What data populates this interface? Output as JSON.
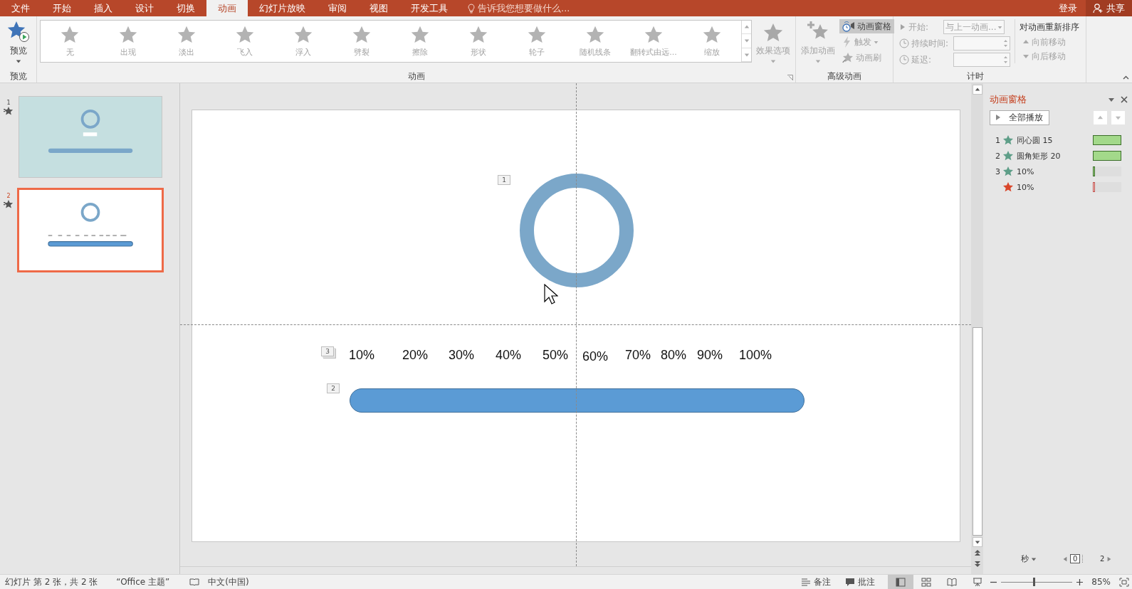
{
  "tabs": [
    {
      "label": "文件",
      "selected": false
    },
    {
      "label": "开始",
      "selected": false
    },
    {
      "label": "插入",
      "selected": false
    },
    {
      "label": "设计",
      "selected": false
    },
    {
      "label": "切换",
      "selected": false
    },
    {
      "label": "动画",
      "selected": true
    },
    {
      "label": "幻灯片放映",
      "selected": false
    },
    {
      "label": "审阅",
      "selected": false
    },
    {
      "label": "视图",
      "selected": false
    },
    {
      "label": "开发工具",
      "selected": false
    }
  ],
  "tell_me": "告诉我您想要做什么...",
  "account": {
    "sign_in": "登录",
    "share": "共享"
  },
  "ribbon": {
    "preview": {
      "button": "预览",
      "group": "预览"
    },
    "animations": {
      "items": [
        {
          "label": "无",
          "disabled": true
        },
        {
          "label": "出现",
          "disabled": true
        },
        {
          "label": "淡出",
          "disabled": true
        },
        {
          "label": "飞入",
          "disabled": true
        },
        {
          "label": "浮入",
          "disabled": true
        },
        {
          "label": "劈裂",
          "disabled": true
        },
        {
          "label": "擦除",
          "disabled": true
        },
        {
          "label": "形状",
          "disabled": true
        },
        {
          "label": "轮子",
          "disabled": true
        },
        {
          "label": "随机线条",
          "disabled": true
        },
        {
          "label": "翻转式由远...",
          "disabled": true
        },
        {
          "label": "缩放",
          "disabled": true
        }
      ],
      "effect_options": {
        "label": "效果选项",
        "disabled": true
      },
      "group": "动画"
    },
    "advanced": {
      "add": {
        "label": "添加动画",
        "disabled": true
      },
      "pane": {
        "label": "动画窗格",
        "selected": true
      },
      "trigger": {
        "label": "触发",
        "disabled": true
      },
      "painter": {
        "label": "动画刷",
        "disabled": true
      },
      "group": "高级动画"
    },
    "timing": {
      "start": {
        "label": "开始:",
        "value": "与上一动画..."
      },
      "duration": {
        "label": "持续时间:"
      },
      "delay": {
        "label": "延迟:"
      },
      "disabled": true,
      "group": "计时"
    },
    "reorder": {
      "title": "对动画重新排序",
      "forward": {
        "label": "向前移动",
        "disabled": true
      },
      "backward": {
        "label": "向后移动",
        "disabled": true
      }
    }
  },
  "thumbnails": [
    {
      "number": "1",
      "selected": false,
      "color": "#c5dfe0"
    },
    {
      "number": "2",
      "selected": true,
      "color": "#ffffff"
    }
  ],
  "slide": {
    "ring_tag": "1",
    "scale_tag": "3",
    "bar_tag": "2",
    "percents": [
      "10%",
      "20%",
      "30%",
      "40%",
      "50%",
      "60%",
      "70%",
      "80%",
      "90%",
      "100%"
    ]
  },
  "animation_pane": {
    "title": "动画窗格",
    "play_all": "全部播放",
    "items": [
      {
        "number": "1",
        "name": "同心圆  15",
        "kind": "entrance",
        "level": 1
      },
      {
        "number": "2",
        "name": "圆角矩形  20",
        "kind": "entrance",
        "level": 1
      },
      {
        "number": "3",
        "name": "10%",
        "kind": "entrance",
        "level": 0.08
      },
      {
        "name": "10%",
        "kind": "exit",
        "level": 0.08
      }
    ],
    "unit": "秒",
    "timeline": [
      "0",
      "2"
    ]
  },
  "status_bar": {
    "slide_info": "幻灯片 第 2 张，共 2 张",
    "theme": "“Office 主题”",
    "language": "中文(中国)",
    "notes": "备注",
    "comments": "批注",
    "zoom_slider": {
      "level": 0.45
    },
    "zoom": "85%"
  }
}
